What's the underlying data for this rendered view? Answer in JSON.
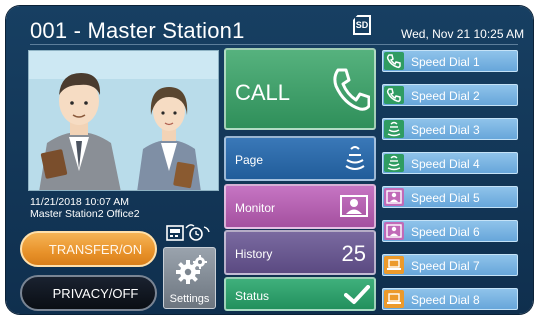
{
  "header": {
    "station_title": "001 - Master Station1",
    "sd_card_label": "SD",
    "datetime": "Wed, Nov 21 10:25 AM"
  },
  "camera": {
    "timestamp": "11/21/2018 10:07 AM",
    "caller": "Master Station2 Office2"
  },
  "controls": {
    "transfer_label": "TRANSFER/ON",
    "privacy_label": "PRIVACY/OFF",
    "settings_label": "Settings"
  },
  "main_buttons": {
    "call_label": "CALL",
    "page_label": "Page",
    "monitor_label": "Monitor",
    "history_label": "History",
    "history_count": "25",
    "status_label": "Status"
  },
  "speed_dials": [
    {
      "label": "Speed Dial 1",
      "icon": "phone-icon"
    },
    {
      "label": "Speed Dial 2",
      "icon": "phone-icon"
    },
    {
      "label": "Speed Dial 3",
      "icon": "paging-speaker-icon"
    },
    {
      "label": "Speed Dial 4",
      "icon": "paging-speaker-icon"
    },
    {
      "label": "Speed Dial 5",
      "icon": "monitor-person-icon"
    },
    {
      "label": "Speed Dial 6",
      "icon": "monitor-person-icon"
    },
    {
      "label": "Speed Dial 7",
      "icon": "laptop-icon"
    },
    {
      "label": "Speed Dial 8",
      "icon": "laptop-icon"
    }
  ],
  "colors": {
    "background": "#173f62",
    "call_green": "#3a9c68",
    "page_blue": "#2d6aab",
    "monitor_pink": "#b862b3",
    "history_purple": "#6a5a92",
    "status_green": "#2ea06a",
    "speed_dial_blue": "#7ab4e3",
    "transfer_orange": "#e8922a"
  }
}
